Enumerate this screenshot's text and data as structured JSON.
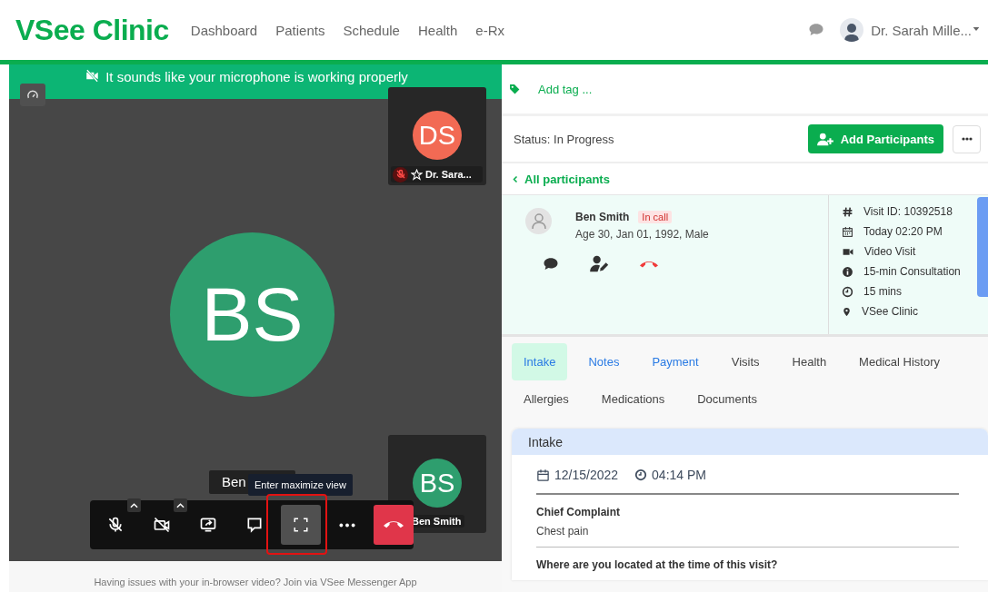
{
  "header": {
    "logo": "VSee Clinic",
    "nav": [
      {
        "label": "Dashboard"
      },
      {
        "label": "Patients"
      },
      {
        "label": "Schedule"
      },
      {
        "label": "Health"
      },
      {
        "label": "e-Rx"
      }
    ],
    "user": "Dr. Sarah Mille..."
  },
  "video": {
    "banner": "It sounds like your microphone is working properly",
    "main_initials": "BS",
    "name_label": "Ben",
    "tooltip": "Enter maximize view",
    "tiles": [
      {
        "initials": "DS",
        "color": "#f26a54",
        "name": "Dr. Sara...",
        "muted": true
      },
      {
        "initials": "BS",
        "color": "#2e9e6e",
        "name": "Ben Smith",
        "muted": false
      }
    ],
    "controls": [
      {
        "kind": "mic-off",
        "menu": true,
        "selected": false
      },
      {
        "kind": "camera-off",
        "menu": true,
        "selected": false
      },
      {
        "kind": "share",
        "menu": false,
        "selected": false
      },
      {
        "kind": "chat",
        "menu": false,
        "selected": false
      },
      {
        "kind": "maximize",
        "menu": false,
        "selected": true
      },
      {
        "kind": "more",
        "menu": false,
        "selected": false
      },
      {
        "kind": "hangup",
        "menu": false,
        "selected": false
      }
    ],
    "footer": "Having issues with your in-browser video? Join via VSee Messenger App"
  },
  "panel": {
    "add_tag": "Add tag ...",
    "status": "Status: In Progress",
    "add_button": "Add Participants",
    "back_link": "All participants",
    "participant": {
      "name": "Ben Smith",
      "badge": "In call",
      "details": "Age 30, Jan 01, 1992, Male"
    },
    "meta": [
      {
        "kind": "hash",
        "text": "Visit ID: 10392518"
      },
      {
        "kind": "calendar",
        "text": "Today 02:20 PM"
      },
      {
        "kind": "video",
        "text": "Video Visit"
      },
      {
        "kind": "info",
        "text": "15-min Consultation"
      },
      {
        "kind": "clock",
        "text": "15 mins"
      },
      {
        "kind": "pin",
        "text": "VSee Clinic"
      }
    ],
    "tabs": [
      {
        "label": "Intake",
        "selected": true,
        "kind": "link"
      },
      {
        "label": "Notes",
        "selected": false,
        "kind": "link"
      },
      {
        "label": "Payment",
        "selected": false,
        "kind": "link"
      },
      {
        "label": "Visits",
        "selected": false,
        "kind": "plain"
      },
      {
        "label": "Health",
        "selected": false,
        "kind": "plain"
      },
      {
        "label": "Medical History",
        "selected": false,
        "kind": "plain"
      },
      {
        "label": "Allergies",
        "selected": false,
        "kind": "plain"
      },
      {
        "label": "Medications",
        "selected": false,
        "kind": "plain"
      },
      {
        "label": "Documents",
        "selected": false,
        "kind": "plain"
      }
    ],
    "intake": {
      "title": "Intake",
      "date": "12/15/2022",
      "time": "04:14 PM",
      "fields": [
        {
          "label": "Chief Complaint",
          "value": "Chest pain"
        },
        {
          "label": "Where are you located at the time of this visit?"
        }
      ]
    }
  }
}
